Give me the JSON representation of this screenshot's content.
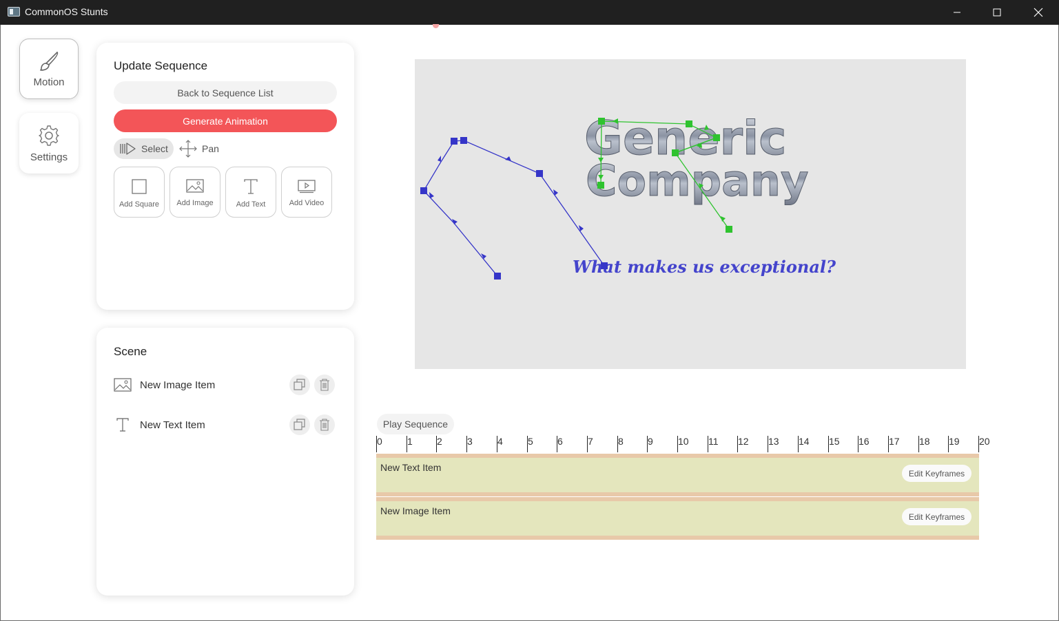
{
  "app": {
    "title": "CommonOS Stunts"
  },
  "nav": [
    {
      "label": "Motion",
      "icon": "brush-icon"
    },
    {
      "label": "Settings",
      "icon": "gear-icon"
    }
  ],
  "sequence_panel": {
    "title": "Update Sequence",
    "back_label": "Back to Sequence List",
    "generate_label": "Generate Animation",
    "tools": [
      {
        "label": "Select",
        "icon": "select-icon",
        "active": true
      },
      {
        "label": "Pan",
        "icon": "pan-icon",
        "active": false
      }
    ],
    "add_buttons": [
      {
        "label": "Add Square",
        "icon": "square-icon"
      },
      {
        "label": "Add Image",
        "icon": "image-icon"
      },
      {
        "label": "Add Text",
        "icon": "text-icon"
      },
      {
        "label": "Add Video",
        "icon": "video-icon"
      }
    ]
  },
  "scene": {
    "title": "Scene",
    "items": [
      {
        "name": "New Image Item",
        "icon": "image-icon"
      },
      {
        "name": "New Text Item",
        "icon": "text-icon"
      }
    ]
  },
  "canvas": {
    "logo_line1": "Generic",
    "logo_line2": "Company",
    "tagline": "What makes us exceptional?",
    "text_path_color": "#3535c8",
    "image_path_color": "#2fc32f",
    "accent_color": "#f35558"
  },
  "timeline": {
    "play_label": "Play Sequence",
    "ruler": [
      "0",
      "1",
      "2",
      "3",
      "4",
      "5",
      "6",
      "7",
      "8",
      "9",
      "10",
      "11",
      "12",
      "13",
      "14",
      "15",
      "16",
      "17",
      "18",
      "19",
      "20"
    ],
    "tracks": [
      {
        "name": "New Text Item",
        "button": "Edit Keyframes"
      },
      {
        "name": "New Image Item",
        "button": "Edit Keyframes"
      }
    ]
  }
}
